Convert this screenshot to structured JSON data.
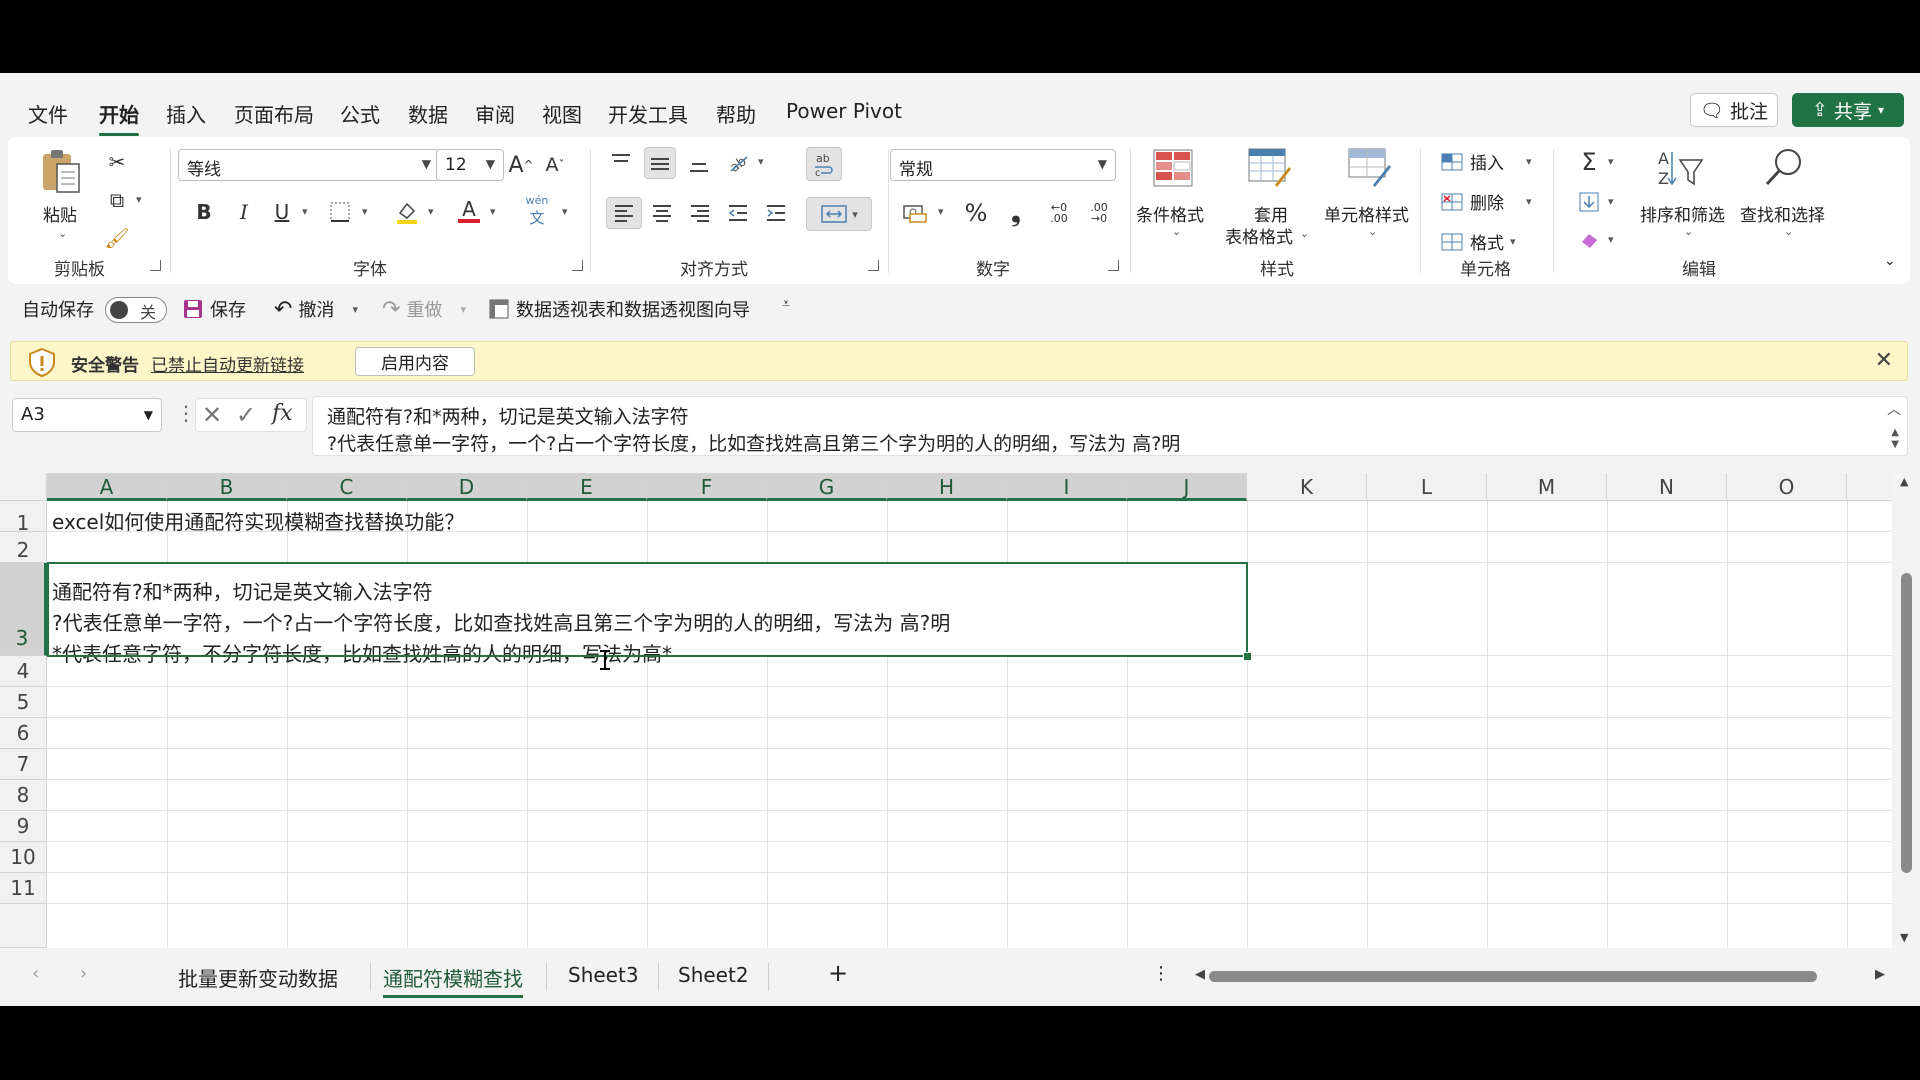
{
  "menu": {
    "tabs": [
      "文件",
      "开始",
      "插入",
      "页面布局",
      "公式",
      "数据",
      "审阅",
      "视图",
      "开发工具",
      "帮助",
      "Power Pivot"
    ],
    "active": "开始",
    "comment_label": "批注",
    "share_label": "共享"
  },
  "ribbon": {
    "clipboard": {
      "paste_label": "粘贴",
      "group": "剪贴板"
    },
    "font": {
      "name": "等线",
      "size": "12",
      "group": "字体",
      "phonetic": "wén"
    },
    "alignment": {
      "group": "对齐方式"
    },
    "number": {
      "format": "常规",
      "group": "数字"
    },
    "styles": {
      "conditional": "条件格式",
      "table_line1": "套用",
      "table_line2": "表格格式",
      "cell_styles": "单元格样式",
      "group": "样式"
    },
    "cells": {
      "insert": "插入",
      "delete": "删除",
      "format": "格式",
      "group": "单元格"
    },
    "editing": {
      "sort": "排序和筛选",
      "find": "查找和选择",
      "group": "编辑"
    }
  },
  "qat": {
    "autosave_label": "自动保存",
    "autosave_state": "关",
    "save": "保存",
    "undo": "撤消",
    "redo": "重做",
    "pivot_wizard": "数据透视表和数据透视图向导"
  },
  "security": {
    "title": "安全警告",
    "message": "已禁止自动更新链接",
    "enable_button": "启用内容"
  },
  "formula_bar": {
    "name_box": "A3",
    "fx": "fx",
    "line1": "通配符有?和*两种，切记是英文输入法字符",
    "line2": "?代表任意单一字符，一个?占一个字符长度，比如查找姓高且第三个字为明的人的明细，写法为 高?明"
  },
  "grid": {
    "columns": [
      "A",
      "B",
      "C",
      "D",
      "E",
      "F",
      "G",
      "H",
      "I",
      "J",
      "K",
      "L",
      "M",
      "N",
      "O"
    ],
    "rows": [
      "1",
      "2",
      "3",
      "4",
      "5",
      "6",
      "7",
      "8",
      "9",
      "10",
      "11"
    ],
    "cells": {
      "A1": "excel如何使用通配符实现模糊查找替换功能？",
      "A3_line1": "通配符有?和*两种，切记是英文输入法字符",
      "A3_line2": "?代表任意单一字符，一个?占一个字符长度，比如查找姓高且第三个字为明的人的明细，写法为 高?明",
      "A3_line3": "*代表任意字符，不分字符长度，比如查找姓高的人的明细，写法为高*"
    }
  },
  "sheets": {
    "tabs": [
      "批量更新变动数据",
      "通配符模糊查找",
      "Sheet3",
      "Sheet2"
    ],
    "active": "通配符模糊查找",
    "add": "+"
  }
}
